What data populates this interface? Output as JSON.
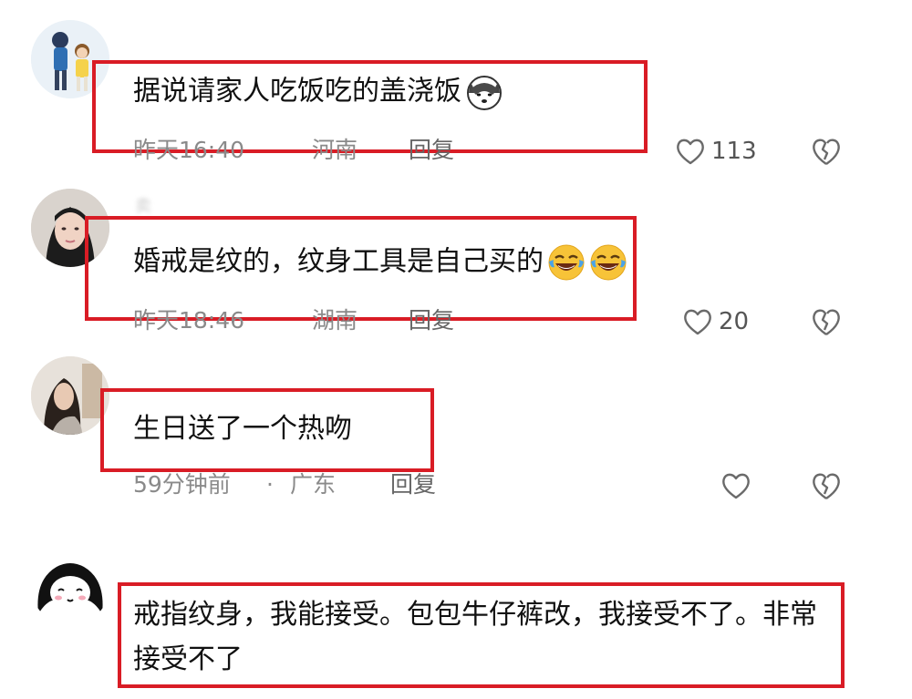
{
  "comments": [
    {
      "avatar": "avatar-couple-cartoon-icon",
      "username": "",
      "text": "据说请家人吃饭吃的盖浇饭",
      "emojis": [
        "husky-dog-emoji"
      ],
      "time": "昨天16:40",
      "location": "河南",
      "reply": "回复",
      "likes": "113"
    },
    {
      "avatar": "avatar-woman-photo-icon",
      "username": "卖",
      "text": "婚戒是纹的，纹身工具是自己买的",
      "emojis": [
        "laughing-crying-emoji",
        "laughing-crying-emoji"
      ],
      "time": "昨天18:46",
      "location": "湖南",
      "reply": "回复",
      "likes": "20"
    },
    {
      "avatar": "avatar-woman-longhair-photo-icon",
      "username": "",
      "text": "生日送了一个热吻",
      "emojis": [],
      "time": "59分钟前",
      "separator": "·",
      "location": "广东",
      "reply": "回复",
      "likes": ""
    },
    {
      "avatar": "avatar-cartoon-girl-icon",
      "username": "",
      "text": "戒指纹身，我能接受。包包牛仔裤改，我接受不了。非常接受不了",
      "emojis": []
    }
  ],
  "colors": {
    "highlight_box": "#d91c25",
    "meta_text": "#8a8a8a",
    "icon_stroke": "#6a6a6a"
  }
}
